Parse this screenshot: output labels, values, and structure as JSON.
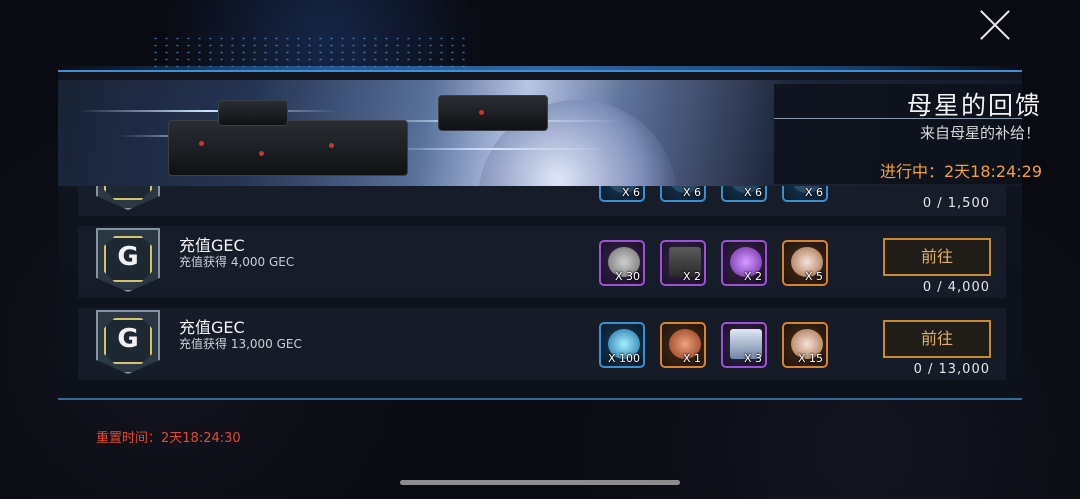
{
  "event": {
    "title": "母星的回馈",
    "subtitle": "来自母星的补给！",
    "status": "进行中：2天18:24:29"
  },
  "tasks": [
    {
      "title": "",
      "desc": "",
      "progress": "0 / 1,500",
      "button": "",
      "rewards": [
        {
          "icon": "token-icon",
          "count": "X 6",
          "rarity": "blue"
        },
        {
          "icon": "module-icon",
          "count": "X 6",
          "rarity": "blue"
        },
        {
          "icon": "module-icon",
          "count": "X 6",
          "rarity": "blue"
        },
        {
          "icon": "module-icon",
          "count": "X 6",
          "rarity": "blue"
        }
      ]
    },
    {
      "title": "充值GEC",
      "desc": "充值获得 4,000 GEC",
      "progress": "0 / 4,000",
      "button": "前往",
      "rewards": [
        {
          "icon": "dog-tag-icon",
          "count": "X 30",
          "rarity": "purple"
        },
        {
          "icon": "crate-icon",
          "count": "X 2",
          "rarity": "purple"
        },
        {
          "icon": "ring-module-icon",
          "count": "X 2",
          "rarity": "purple"
        },
        {
          "icon": "egg-crystal-icon",
          "count": "X 5",
          "rarity": "orange"
        }
      ]
    },
    {
      "title": "充值GEC",
      "desc": "充值获得 13,000 GEC",
      "progress": "0 / 13,000",
      "button": "前往",
      "rewards": [
        {
          "icon": "hexagon-core-icon",
          "count": "X 100",
          "rarity": "blue"
        },
        {
          "icon": "ring-module-icon",
          "count": "X 1",
          "rarity": "orange"
        },
        {
          "icon": "chest-icon",
          "count": "X 3",
          "rarity": "purple"
        },
        {
          "icon": "egg-crystal-icon",
          "count": "X 15",
          "rarity": "orange"
        }
      ]
    }
  ],
  "reset": "重置时间：2天18:24:30",
  "colors": {
    "accent": "#f0a040",
    "reset": "#e34a33",
    "frame": "#3d8fd6"
  }
}
